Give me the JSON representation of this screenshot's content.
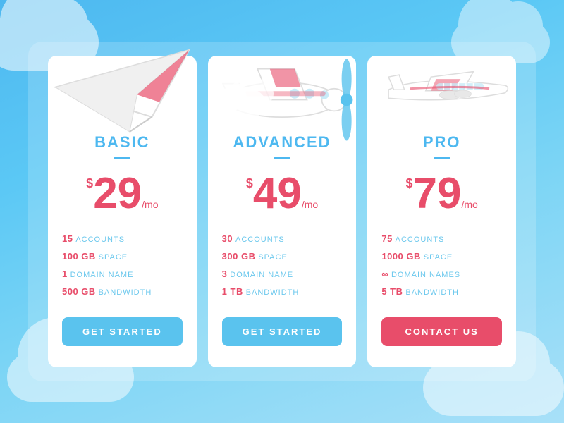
{
  "background": {
    "color_top": "#4db8f0",
    "color_bottom": "#a8e0f8"
  },
  "plans": [
    {
      "id": "basic",
      "name": "BASIC",
      "icon": "paper-plane",
      "price_dollar": "$",
      "price_amount": "29",
      "price_period": "/mo",
      "features": [
        {
          "number": "15",
          "label": "ACCOUNTS"
        },
        {
          "number": "100 GB",
          "label": "SPACE"
        },
        {
          "number": "1",
          "label": "DOMAIN NAME"
        },
        {
          "number": "500 GB",
          "label": "BANDWIDTH"
        }
      ],
      "cta_label": "GET STARTED",
      "cta_type": "default"
    },
    {
      "id": "advanced",
      "name": "ADVANCED",
      "icon": "prop-plane",
      "price_dollar": "$",
      "price_amount": "49",
      "price_period": "/mo",
      "features": [
        {
          "number": "30",
          "label": "ACCOUNTS"
        },
        {
          "number": "300 GB",
          "label": "SPACE"
        },
        {
          "number": "3",
          "label": "DOMAIN NAME"
        },
        {
          "number": "1 TB",
          "label": "BANDWIDTH"
        }
      ],
      "cta_label": "GET STARTED",
      "cta_type": "default"
    },
    {
      "id": "pro",
      "name": "PRO",
      "icon": "jet-plane",
      "price_dollar": "$",
      "price_amount": "79",
      "price_period": "/mo",
      "features": [
        {
          "number": "75",
          "label": "ACCOUNTS"
        },
        {
          "number": "1000 GB",
          "label": "SPACE"
        },
        {
          "number": "∞",
          "label": "DOMAIN NAMES"
        },
        {
          "number": "5 TB",
          "label": "BANDWIDTH"
        }
      ],
      "cta_label": "CONTACT US",
      "cta_type": "contact"
    }
  ]
}
